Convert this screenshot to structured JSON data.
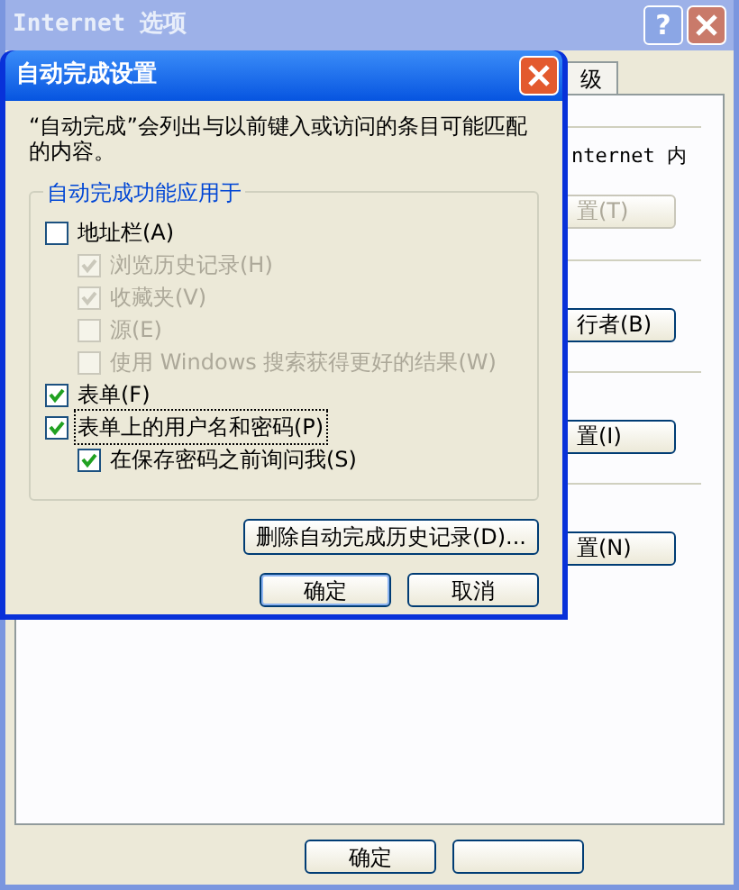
{
  "back_window": {
    "title": "Internet 选项",
    "help": "?",
    "tab": {
      "label": "级",
      "selected": false
    },
    "text": "nternet 内",
    "buttons": [
      {
        "label": "置(T)",
        "disabled": true
      },
      {
        "label": "行者(B)",
        "disabled": false
      },
      {
        "label": "置(I)",
        "disabled": false
      },
      {
        "label": "置(N)",
        "disabled": false
      }
    ],
    "footer_button": "确定"
  },
  "dialog": {
    "title": "自动完成设置",
    "description": "“自动完成”会列出与以前键入或访问的条目可能匹配的内容。",
    "group_title": "自动完成功能应用于",
    "options": [
      {
        "label": "地址栏(A)",
        "checked": false,
        "disabled": false,
        "focused": false,
        "children": [
          {
            "label": "浏览历史记录(H)",
            "checked": true,
            "disabled": true,
            "focused": false
          },
          {
            "label": "收藏夹(V)",
            "checked": true,
            "disabled": true,
            "focused": false
          },
          {
            "label": "源(E)",
            "checked": false,
            "disabled": true,
            "focused": false
          },
          {
            "label": "使用 Windows 搜索获得更好的结果(W)",
            "checked": false,
            "disabled": true,
            "focused": false
          }
        ]
      },
      {
        "label": "表单(F)",
        "checked": true,
        "disabled": false,
        "focused": false
      },
      {
        "label": "表单上的用户名和密码(P)",
        "checked": true,
        "disabled": false,
        "focused": true,
        "children": [
          {
            "label": "在保存密码之前询问我(S)",
            "checked": true,
            "disabled": false,
            "focused": false
          }
        ]
      }
    ],
    "delete_button": "删除自动完成历史记录(D)...",
    "ok_button": "确定",
    "cancel_button": "取消"
  }
}
